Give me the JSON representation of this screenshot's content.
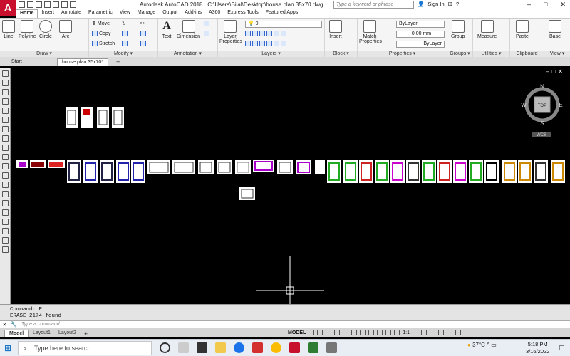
{
  "app": {
    "logo_letter": "A",
    "product": "Autodesk AutoCAD 2018",
    "file_path": "C:\\Users\\Bilal\\Desktop\\house plan 35x70.dwg",
    "search_placeholder": "Type a keyword or phrase",
    "sign_in": "Sign In"
  },
  "ribbon_tabs": [
    "Home",
    "Insert",
    "Annotate",
    "Parametric",
    "View",
    "Manage",
    "Output",
    "Add-ins",
    "A360",
    "Express Tools",
    "Featured Apps"
  ],
  "ribbon": {
    "draw": {
      "title": "Draw ▾",
      "tools": [
        "Line",
        "Polyline",
        "Circle",
        "Arc"
      ]
    },
    "modify": {
      "title": "Modify ▾",
      "tools": [
        "Move",
        "Copy",
        "Stretch"
      ]
    },
    "annotation": {
      "title": "Annotation ▾",
      "tools": [
        "Text",
        "Dimension"
      ]
    },
    "layers": {
      "title": "Layers ▾",
      "tool": "Layer Properties",
      "layer_value": "0"
    },
    "block": {
      "title": "Block ▾",
      "tool": "Insert"
    },
    "properties": {
      "title": "Properties ▾",
      "tool": "Match Properties",
      "color": "ByLayer",
      "lineweight": "0.00 mm",
      "linetype": "ByLayer"
    },
    "groups": {
      "title": "Groups ▾",
      "tool": "Group"
    },
    "utilities": {
      "title": "Utilities ▾",
      "tool": "Measure"
    },
    "clipboard": {
      "title": "Clipboard",
      "tool": "Paste"
    },
    "view": {
      "title": "View ▾",
      "tool": "Base"
    }
  },
  "doc_tabs": [
    "Start",
    "house plan 35x70*"
  ],
  "viewcube": {
    "n": "N",
    "s": "S",
    "e": "E",
    "w": "W",
    "face": "TOP",
    "wcs": "WCS"
  },
  "command": {
    "line1": "Command: E",
    "line2": "ERASE 2174 found",
    "placeholder": "Type a command"
  },
  "layout_tabs": [
    "Model",
    "Layout1",
    "Layout2"
  ],
  "status": {
    "model": "MODEL",
    "scale": "1:1"
  },
  "taskbar": {
    "search": "Type here to search",
    "weather": "37°C",
    "time": "5:18 PM",
    "date": "3/16/2022"
  },
  "colors": {
    "accent": "#c8102e",
    "canvas": "#000000",
    "ribbon": "#f5f5f5"
  }
}
